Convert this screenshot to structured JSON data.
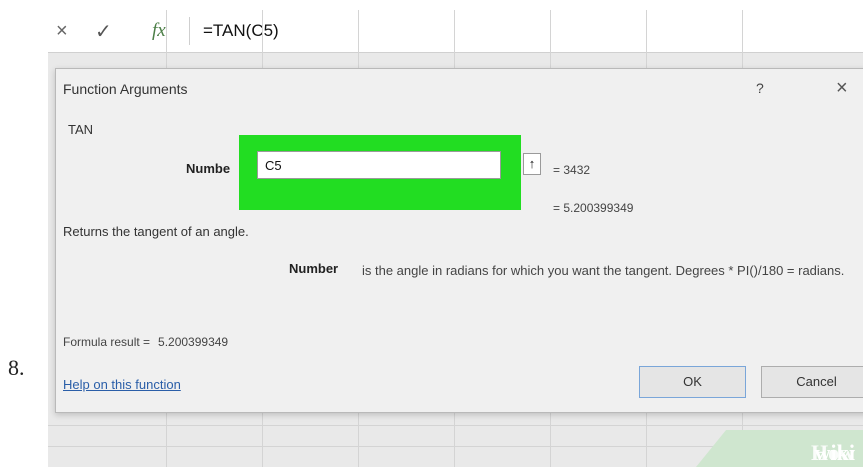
{
  "step": {
    "number": "8."
  },
  "formula_bar": {
    "cancel_icon": "×",
    "enter_icon": "✓",
    "fx_label": "fx",
    "formula": "=TAN(C5)"
  },
  "dialog": {
    "title": "Function Arguments",
    "help_label": "?",
    "close_label": "×",
    "function_name": "TAN",
    "argument": {
      "label": "Numbe",
      "value": "C5",
      "collapse_icon": "↑",
      "evaluated": "=   3432"
    },
    "function_value": "=   5.200399349",
    "description": "Returns the tangent of an angle.",
    "argument_description": {
      "label": "Number",
      "text": "is the angle in radians for which you want the tangent. Degrees * PI()/180 = radians."
    },
    "formula_result": {
      "label": "Formula result =",
      "value": "5.200399349"
    },
    "help_link": "Help on this function",
    "ok_label": "OK",
    "cancel_label": "Cancel"
  },
  "highlight_color": "#22dd22",
  "watermark": {
    "part1": "wiki",
    "part2": "How"
  }
}
